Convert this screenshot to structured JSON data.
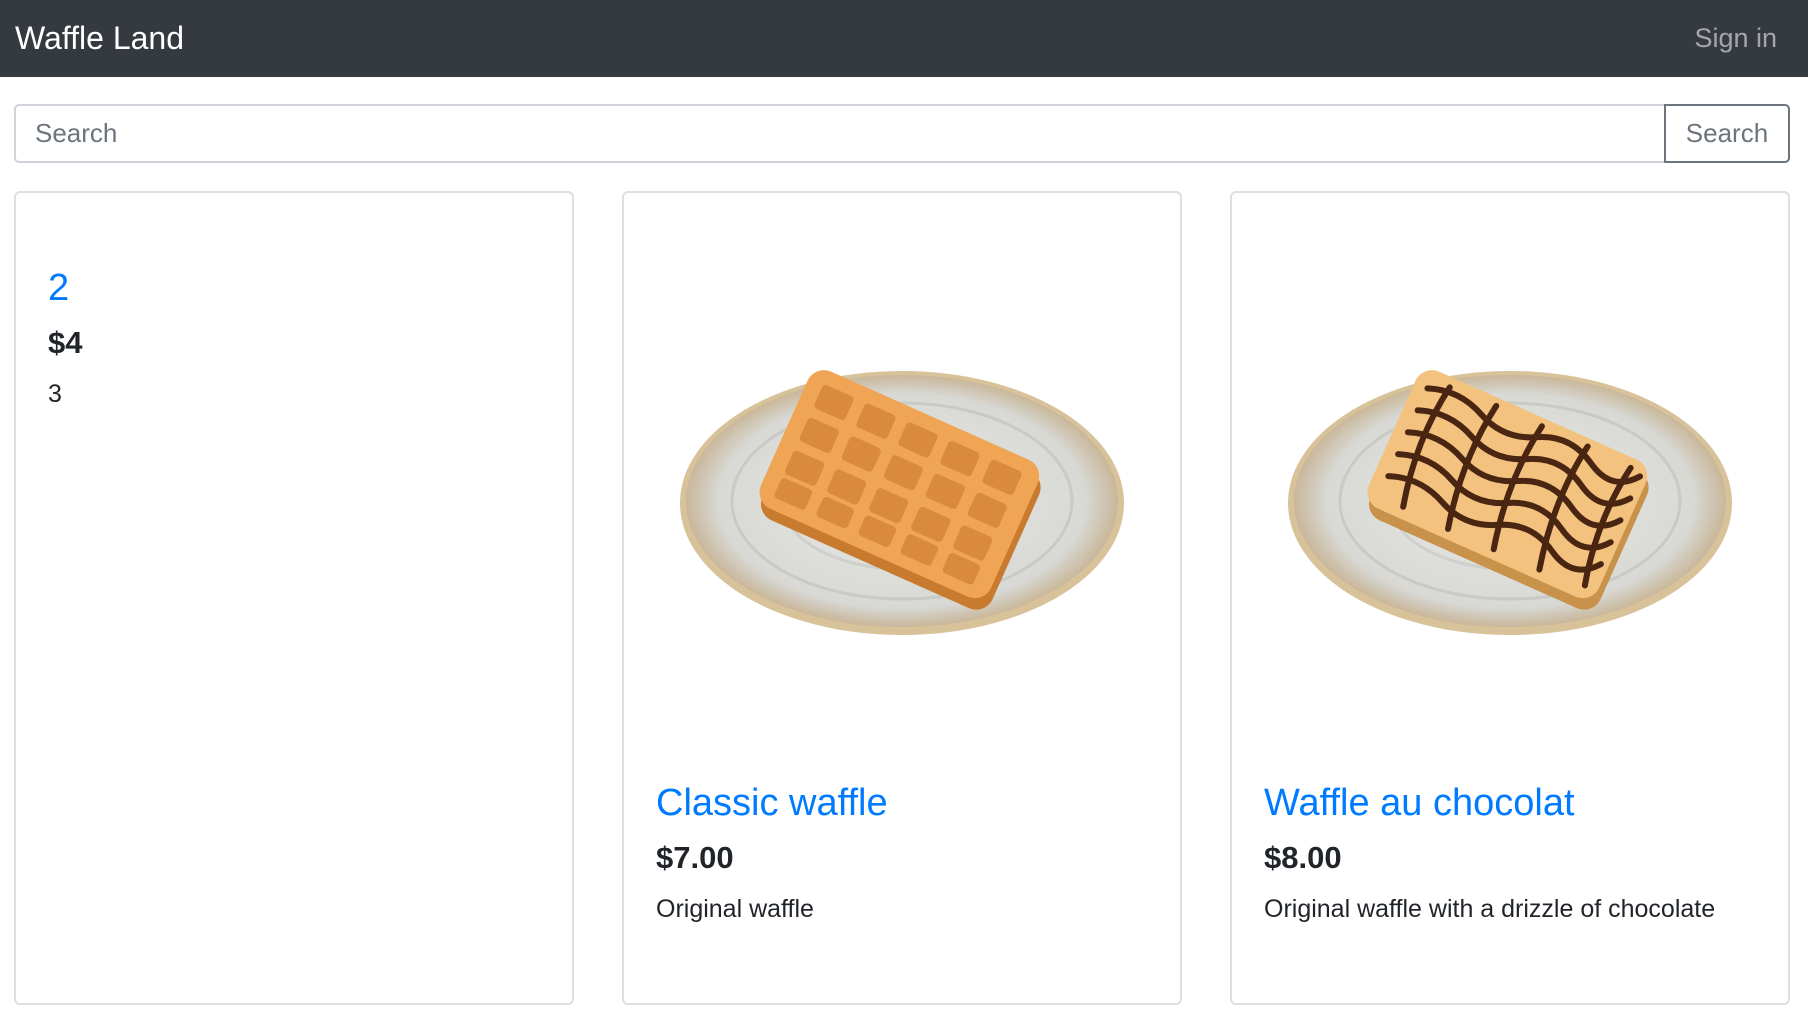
{
  "navbar": {
    "brand": "Waffle Land",
    "signin": "Sign in"
  },
  "search": {
    "placeholder": "Search",
    "button_label": "Search"
  },
  "cards": [
    {
      "title": "2",
      "price": "$4",
      "description": "3"
    },
    {
      "title": "Classic waffle",
      "price": "$7.00",
      "description": "Original waffle"
    },
    {
      "title": "Waffle au chocolat",
      "price": "$8.00",
      "description": "Original waffle with a drizzle of chocolate"
    }
  ],
  "colors": {
    "navbar_bg": "#343a40",
    "link": "#007bff",
    "text": "#212529",
    "muted": "#6c757d",
    "border": "#dfdfdf"
  }
}
